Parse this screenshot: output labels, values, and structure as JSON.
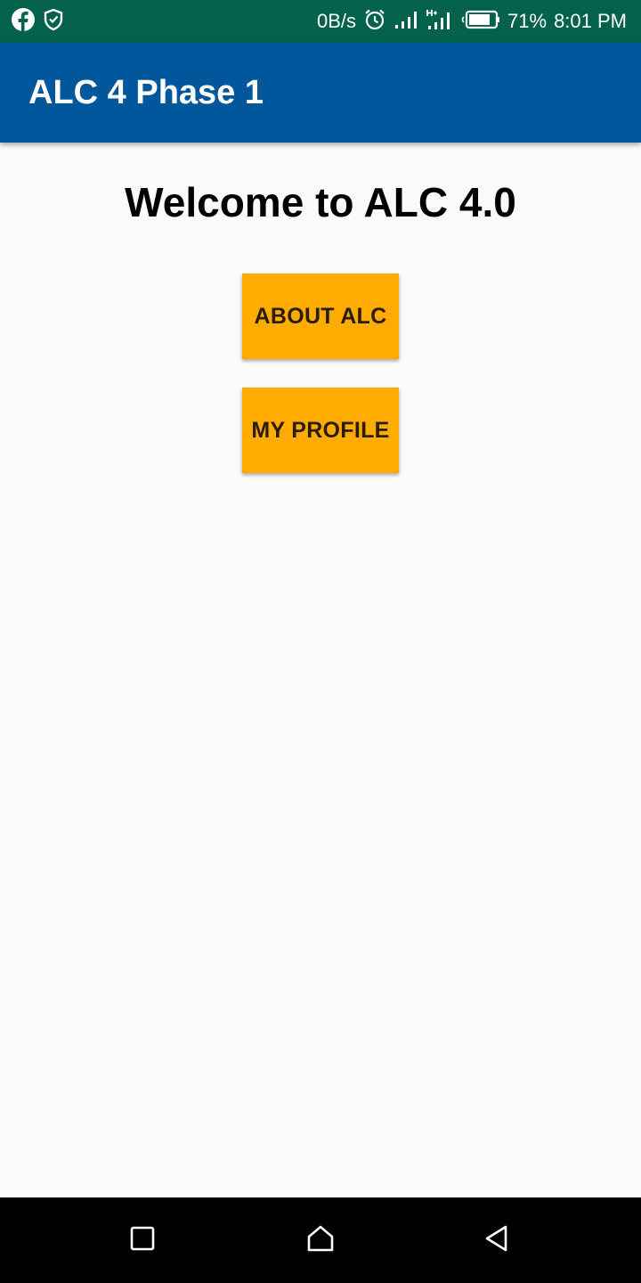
{
  "status_bar": {
    "net_speed": "0B/s",
    "battery_percent": "71%",
    "time": "8:01 PM",
    "icons": [
      "facebook-icon",
      "shield-icon",
      "alarm-icon",
      "signal-icon",
      "signal-h-icon",
      "battery-icon"
    ]
  },
  "app_bar": {
    "title": "ALC 4 Phase 1",
    "color": "#01579b"
  },
  "main": {
    "welcome": "Welcome to ALC 4.0",
    "about_button": "ABOUT ALC",
    "profile_button": "MY PROFILE",
    "button_color": "#ffab00"
  },
  "nav_bar": {
    "icons": [
      "recent-apps-icon",
      "home-icon",
      "back-icon"
    ]
  }
}
